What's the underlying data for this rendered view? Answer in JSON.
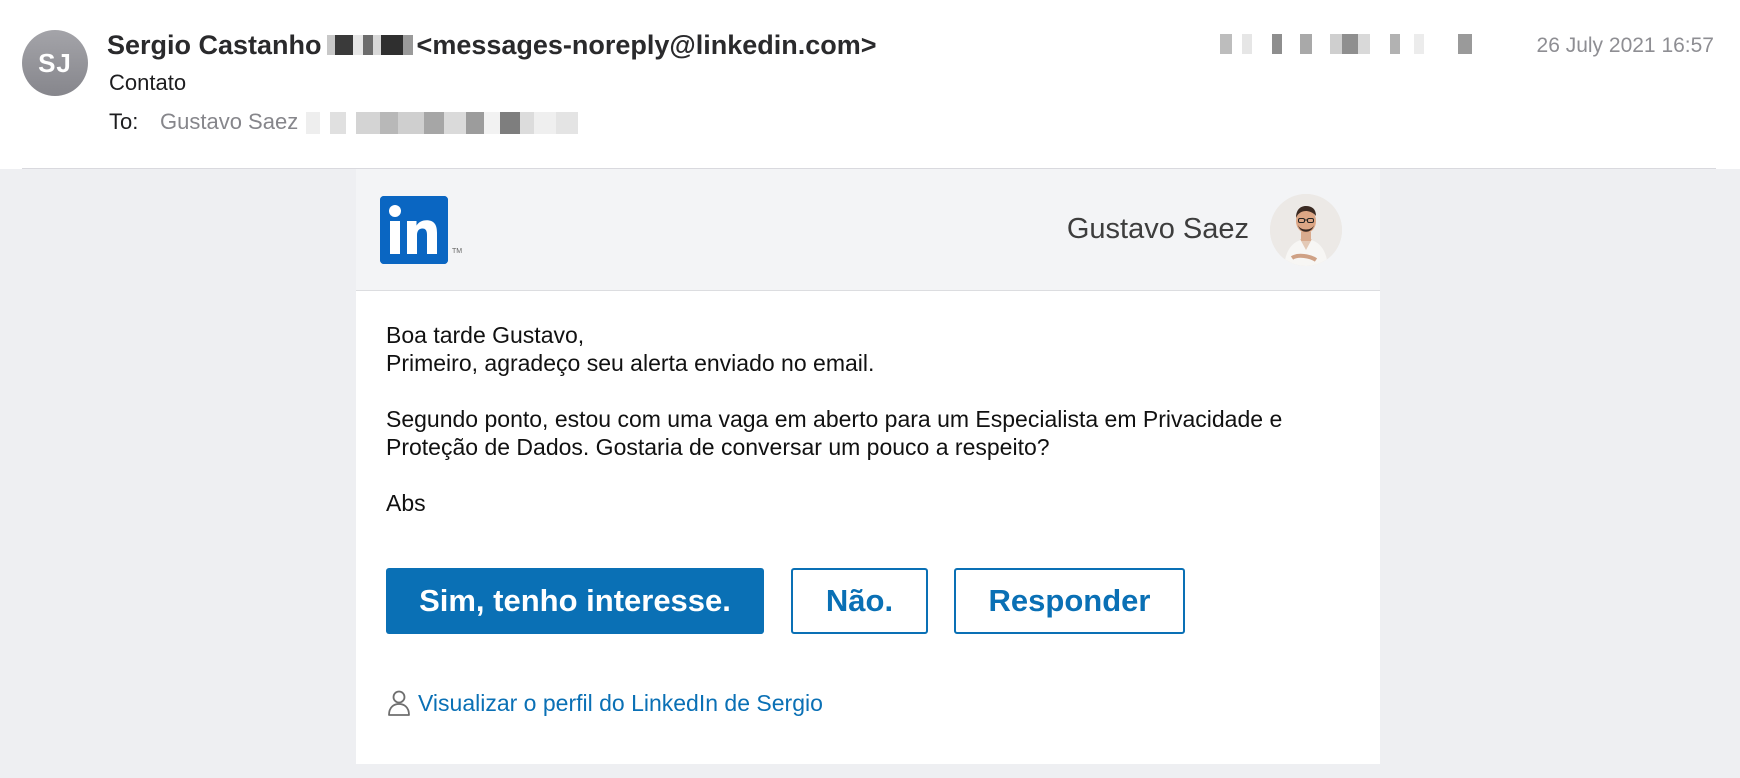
{
  "header": {
    "sender_initials": "SJ",
    "sender_name": "Sergio Castanho",
    "sender_email": "<messages-noreply@linkedin.com>",
    "subject": "Contato",
    "to_label": "To:",
    "to_name": "Gustavo Saez",
    "date": "26 July 2021 16:57"
  },
  "card": {
    "logo_icon": "linkedin-logo-icon",
    "recipient_name": "Gustavo Saez",
    "message": {
      "line1": "Boa tarde Gustavo,",
      "line2": "Primeiro, agradeço seu alerta enviado no email.",
      "line3": "Segundo ponto, estou com uma vaga em aberto para um Especialista em Privacidade e",
      "line4": "Proteção de Dados. Gostaria de conversar um pouco a respeito?",
      "line5": "Abs"
    },
    "buttons": {
      "yes": "Sim, tenho interesse.",
      "no": "Não.",
      "reply": "Responder"
    },
    "profile_link": "Visualizar o perfil do LinkedIn de Sergio",
    "profile_icon": "person-icon"
  },
  "colors": {
    "linkedin_blue": "#0a66c2",
    "button_blue": "#0a70b5",
    "body_background": "#eeeff2"
  }
}
